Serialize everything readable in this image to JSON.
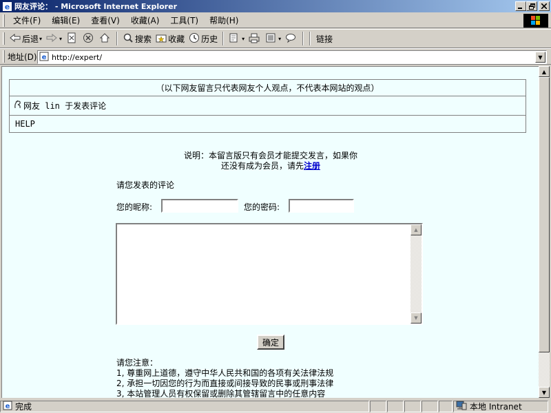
{
  "window": {
    "title": "网友评论： - Microsoft Internet Explorer",
    "minimize": "_",
    "restore": "❐",
    "close": "✕"
  },
  "menu": [
    "文件(F)",
    "编辑(E)",
    "查看(V)",
    "收藏(A)",
    "工具(T)",
    "帮助(H)"
  ],
  "toolbar": {
    "back": "后退",
    "search": "搜索",
    "favorites": "收藏",
    "history": "历史",
    "links": "链接"
  },
  "address": {
    "label": "地址(D)",
    "url": "http://expert/"
  },
  "page": {
    "disclaimer": "（以下网友留言只代表网友个人观点，不代表本网站的观点）",
    "comment_user_line": "网友 lin 于发表评论",
    "comment_body": "HELP",
    "notice_line1": "说明：本留言版只有会员才能提交发言，如果你",
    "notice_line2": "还没有成为会员，请先",
    "register_link": "注册",
    "form_heading": "请您发表的评论",
    "nickname_label": "您的昵称:",
    "password_label": "您的密码:",
    "nickname_value": "",
    "password_value": "",
    "submit_label": "确定",
    "rules_heading": "请您注意：",
    "rules": [
      "1, 尊重网上道德，遵守中华人民共和国的各项有关法律法规",
      "2, 承担一切因您的行为而直接或间接导致的民事或刑事法律",
      "3, 本站管理人员有权保留或删除其管辖留言中的任意内容"
    ]
  },
  "status": {
    "text": "完成",
    "zone": "本地 Intranet"
  }
}
